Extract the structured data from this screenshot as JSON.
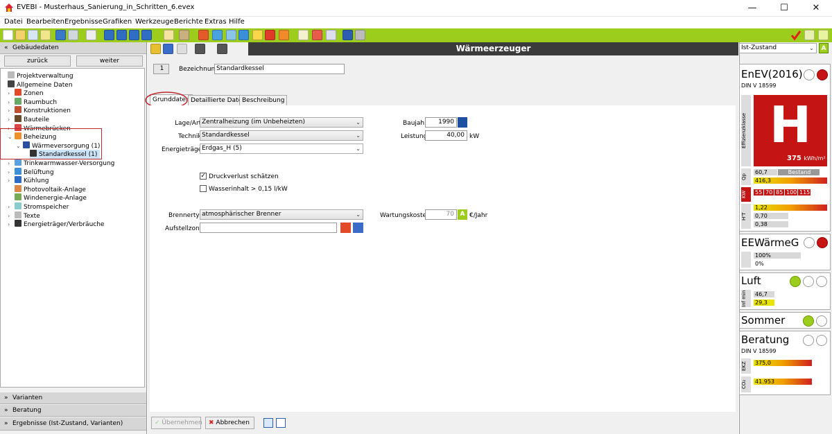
{
  "window": {
    "title": "EVEBI - Musterhaus_Sanierung_in_Schritten_6.evex",
    "min": "—",
    "max": "☐",
    "close": "✕"
  },
  "menu": [
    "Datei",
    "Bearbeiten",
    "Ergebnisse",
    "Grafiken",
    "Werkzeuge",
    "Berichte",
    "Extras",
    "Hilfe"
  ],
  "colors": {
    "toolbar": "#9ccc1c",
    "accent_red": "#c0282d",
    "header_dark": "#3b3b3b",
    "yellow": "#e8e400"
  },
  "left": {
    "section_title": "Gebäudedaten",
    "back": "zurück",
    "forward": "weiter",
    "tree": [
      {
        "label": "Projektverwaltung",
        "icon": "gear-icon"
      },
      {
        "label": "Allgemeine Daten",
        "icon": "person-icon"
      },
      {
        "label": "Zonen",
        "icon": "house-icon"
      },
      {
        "label": "Raumbuch",
        "icon": "book-icon"
      },
      {
        "label": "Konstruktionen",
        "icon": "wall-icon"
      },
      {
        "label": "Bauteile",
        "icon": "window-icon"
      },
      {
        "label": "Wärmebrücken",
        "icon": "bridge-icon"
      },
      {
        "label": "Beheizung",
        "icon": "heating-icon"
      },
      {
        "label": "Wärmeversorgung (1)",
        "icon": "radiator-icon"
      },
      {
        "label": "Standardkessel (1)",
        "icon": "boiler-icon"
      },
      {
        "label": "Trinkwarmwasser-Versorgung",
        "icon": "water-icon"
      },
      {
        "label": "Belüftung",
        "icon": "fan-icon"
      },
      {
        "label": "Kühlung",
        "icon": "snow-icon"
      },
      {
        "label": "Photovoltaik-Anlage",
        "icon": "solar-icon"
      },
      {
        "label": "Windenergie-Anlage",
        "icon": "wind-icon"
      },
      {
        "label": "Stromspeicher",
        "icon": "battery-icon"
      },
      {
        "label": "Texte",
        "icon": "text-icon"
      },
      {
        "label": "Energieträger/Verbräuche",
        "icon": "fuel-icon"
      }
    ],
    "sections": [
      "Varianten",
      "Beratung",
      "Ergebnisse (Ist-Zustand, Varianten)"
    ]
  },
  "main": {
    "header": "Wärmeerzeuger",
    "index": "1",
    "name_label": "Bezeichnung",
    "name_value": "Standardkessel",
    "tabs": [
      "Grunddaten",
      "Detaillierte Daten",
      "Beschreibung"
    ],
    "lage_label": "Lage/Art",
    "lage_value": "Zentralheizung (im Unbeheizten)",
    "technik_label": "Technik",
    "technik_value": "Standardkessel",
    "energie_label": "Energieträger",
    "energie_value": "Erdgas_H (5)",
    "baujahr_label": "Baujahr",
    "baujahr_value": "1990",
    "leistung_label": "Leistung",
    "leistung_value": "40,00",
    "leistung_unit": "kW",
    "druck_label": "Druckverlust schätzen",
    "druck_checked": true,
    "wasser_label": "Wasserinhalt > 0,15 l/kW",
    "wasser_checked": false,
    "brenner_label": "Brennertyp",
    "brenner_value": "atmosphärischer Brenner",
    "wartung_label": "Wartungskosten",
    "wartung_value": "70",
    "wartung_unit": "€/Jahr",
    "aufstell_label": "Aufstellzone",
    "aufstell_value": "",
    "apply": "Übernehmen",
    "cancel": "Abbrechen",
    "a_badge": "A"
  },
  "right": {
    "state": "Ist-Zustand",
    "state_badge": "A",
    "enev_title": "EnEV(2016)",
    "enev_sub": "DIN V 18599",
    "effizienz_label": "Effizienzklasse",
    "class_letter": "H",
    "class_value": "375",
    "class_unit": "kWh/m²",
    "qp_label": "Qp",
    "qp_bestand": "60,7",
    "bestand_label": "Bestand",
    "qp_ist": "416,3",
    "kw_label": "KW",
    "kw_values": [
      "55",
      "70",
      "85",
      "100",
      "115"
    ],
    "ht_label": "H'T",
    "ht_values": [
      "1,22",
      "0,70",
      "0,38"
    ],
    "eew_title": "EEWärmeG",
    "eew_values": [
      "100%",
      "0%"
    ],
    "luft_title": "Luft",
    "luft_label": "Inf min",
    "luft_values": [
      "46,7",
      "29,3"
    ],
    "sommer_title": "Sommer",
    "beratung_title": "Beratung",
    "beratung_sub": "DIN V 18599",
    "ekz_label": "EKZ",
    "ekz_value": "375,0",
    "co2_label": "CO₂",
    "co2_value": "41.953"
  }
}
